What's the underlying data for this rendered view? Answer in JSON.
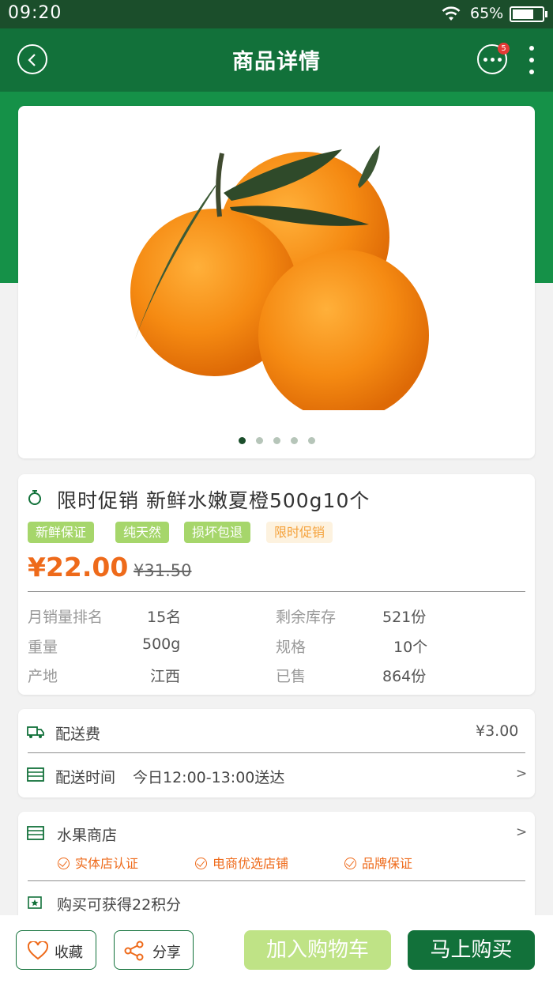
{
  "status_bar": {
    "time": "09:20",
    "battery": "65%",
    "battery_level": 0.65
  },
  "header": {
    "title": "商品详情",
    "message_badge": "5"
  },
  "gallery": {
    "total_images": 5,
    "current_index": 1
  },
  "product": {
    "title": "限时促销 新鲜水嫩夏橙500g10个",
    "tags": [
      {
        "label": "新鲜保证",
        "style": "green"
      },
      {
        "label": "纯天然",
        "style": "green"
      },
      {
        "label": "损坏包退",
        "style": "green"
      },
      {
        "label": "限时促销",
        "style": "orange"
      }
    ],
    "price": "¥22.00",
    "original_price": "¥31.50",
    "attributes": [
      {
        "label": "月销量排名",
        "value": "15名"
      },
      {
        "label": "剩余库存",
        "value": "521份"
      },
      {
        "label": "重量",
        "value": "500g"
      },
      {
        "label": "规格",
        "value": "10个"
      },
      {
        "label": "产地",
        "value": "江西"
      },
      {
        "label": "已售",
        "value": "864份"
      }
    ]
  },
  "delivery": {
    "fee_label": "配送费",
    "fee_value": "¥3.00",
    "time_label": "配送时间",
    "time_value": "今日12:00-13:00送达",
    "arrow": ">"
  },
  "shop": {
    "name": "水果商店",
    "arrow": ">",
    "certifications": [
      "实体店认证",
      "电商优选店铺",
      "品牌保证"
    ],
    "points": "购买可获得22积分"
  },
  "bottom_bar": {
    "favorite": "收藏",
    "share": "分享",
    "add_to_cart": "加入购物车",
    "buy_now": "马上购买"
  },
  "colors": {
    "header_green": "#12713a",
    "band_green": "#159148",
    "price_orange": "#ee6a1a",
    "tag_green": "#a6d66b",
    "cart_button": "#bfe386"
  }
}
